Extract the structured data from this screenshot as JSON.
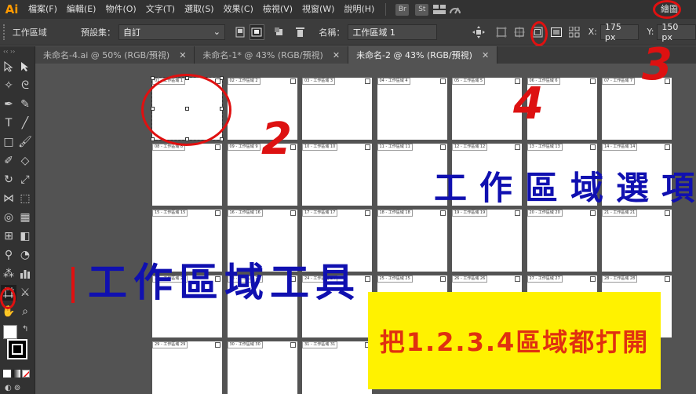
{
  "menubar": {
    "logo": "Ai",
    "items": [
      "檔案(F)",
      "編輯(E)",
      "物件(O)",
      "文字(T)",
      "選取(S)",
      "效果(C)",
      "檢視(V)",
      "視窗(W)",
      "說明(H)"
    ],
    "bridge_badge": "Br",
    "stock_badge": "St",
    "workspace": "繪圖"
  },
  "controlbar": {
    "tool_name": "工作區域",
    "preset_label": "預設集：",
    "preset_value": "自訂",
    "name_label": "名稱：",
    "name_value": "工作區域 1",
    "x_label": "X:",
    "x_value": "175 px",
    "y_label": "Y:",
    "y_value": "150 px"
  },
  "tabs": [
    {
      "label": "未命名-4.ai @ 50% (RGB/預視)",
      "active": false
    },
    {
      "label": "未命名-1* @ 43% (RGB/預視)",
      "active": false
    },
    {
      "label": "未命名-2 @ 43% (RGB/預視)",
      "active": true
    }
  ],
  "artboards": [
    "01 - 工作區域 1",
    "02 - 工作區域 2",
    "03 - 工作區域 3",
    "04 - 工作區域 4",
    "05 - 工作區域 5",
    "06 - 工作區域 6",
    "07 - 工作區域 7",
    "08 - 工作區域 8",
    "09 - 工作區域 9",
    "10 - 工作區域 10",
    "11 - 工作區域 11",
    "12 - 工作區域 12",
    "13 - 工作區域 13",
    "14 - 工作區域 14",
    "15 - 工作區域 15",
    "16 - 工作區域 16",
    "17 - 工作區域 17",
    "18 - 工作區域 18",
    "19 - 工作區域 19",
    "20 - 工作區域 20",
    "21 - 工作區域 21",
    "22 - 工作區域 22",
    "23 - 工作區域 23",
    "24 - 工作區域 24",
    "25 - 工作區域 25",
    "26 - 工作區域 26",
    "27 - 工作區域 27",
    "28 - 工作區域 28",
    "29 - 工作區域 29",
    "30 - 工作區域 30",
    "31 - 工作區域 31"
  ],
  "annotations": {
    "num2": "2",
    "num3": "3",
    "num4": "4",
    "options_text": "工作區域選項",
    "tool_text": "工作區域工具",
    "note": "把1.2.3.4區域都打開"
  }
}
